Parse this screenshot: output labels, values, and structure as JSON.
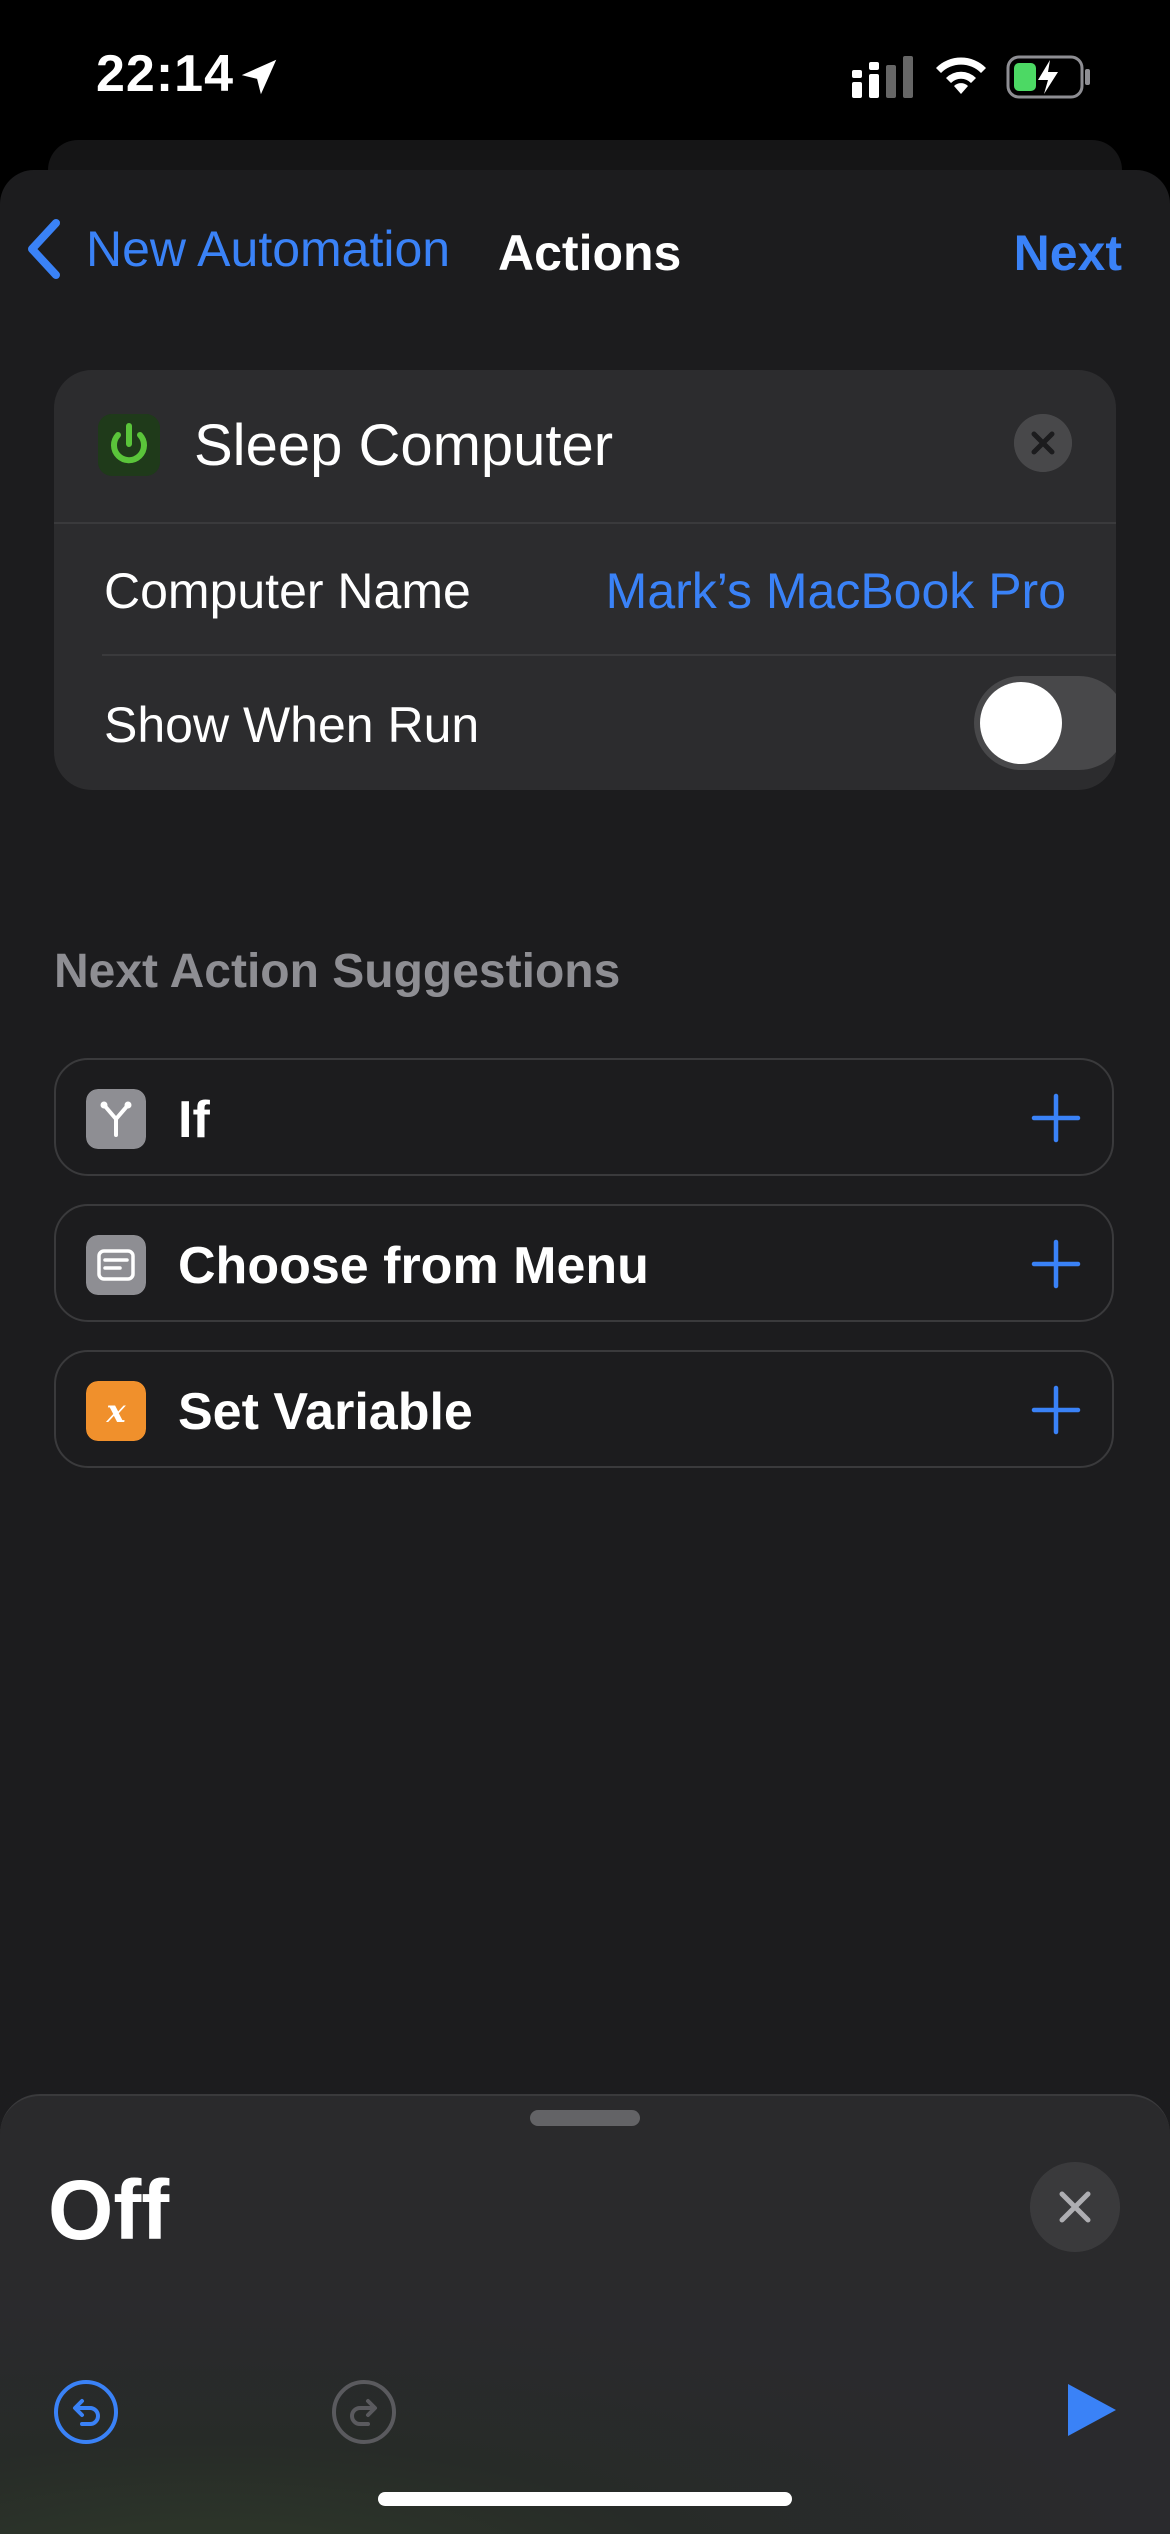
{
  "status_bar": {
    "time": "22:14"
  },
  "nav": {
    "back_label": "New Automation",
    "title": "Actions",
    "next_label": "Next"
  },
  "action_card": {
    "title": "Sleep Computer",
    "rows": [
      {
        "label": "Computer Name",
        "value": "Mark’s MacBook Pro"
      },
      {
        "label": "Show When Run",
        "toggle": false
      }
    ]
  },
  "suggestions": {
    "header": "Next Action Suggestions",
    "items": [
      {
        "label": "If",
        "icon": "branch-icon",
        "color": "#8e8e93"
      },
      {
        "label": "Choose from Menu",
        "icon": "menu-icon",
        "color": "#8e8e93"
      },
      {
        "label": "Set Variable",
        "icon": "variable-icon",
        "color": "#f0902c"
      }
    ]
  },
  "bottom_panel": {
    "title": "Off"
  },
  "colors": {
    "accent": "#3a82f7",
    "background": "#1c1c1e",
    "card": "#2c2c2e"
  }
}
